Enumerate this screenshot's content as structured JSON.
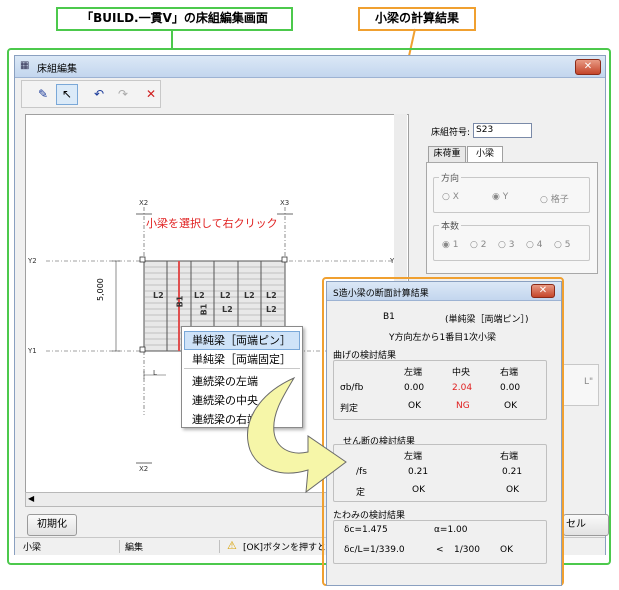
{
  "callouts": {
    "left": "「BUILD.一貫Ⅴ」の床組編集画面",
    "right": "小梁の計算結果"
  },
  "window": {
    "title": "床組編集",
    "close": "✕"
  },
  "toolbar": {
    "pen": "✎",
    "select": "↖",
    "undo": "↶",
    "redo": "↷",
    "delete": "✕"
  },
  "drawing": {
    "axes": [
      "X2",
      "X3",
      "X2",
      "X3",
      "Y2",
      "Y1",
      "Y2"
    ],
    "dimension": "5,000",
    "instruction": "小梁を選択して右クリック",
    "beam_labels": [
      "L2",
      "B1",
      "L2",
      "L2",
      "L2",
      "L2",
      "B1",
      "L2",
      "L2"
    ],
    "corner_label": "L"
  },
  "right_panel": {
    "floor_code_label": "床組符号:",
    "floor_code_value": "S23",
    "tabs": [
      "床荷重",
      "小梁"
    ],
    "direction": {
      "label": "方向",
      "options": [
        "X",
        "Y",
        "格子"
      ]
    },
    "count": {
      "label": "本数",
      "options": [
        "1",
        "2",
        "3",
        "4",
        "5"
      ]
    },
    "hidden_text": "L\""
  },
  "context_menu": {
    "items": [
      "単純梁［両端ピン］",
      "単純梁［両端固定］",
      "連続梁の左端",
      "連続梁の中央",
      "連続梁の右端"
    ]
  },
  "buttons": {
    "init": "初期化",
    "cancel": "セル"
  },
  "status": {
    "cell1": "小梁",
    "cell2": "編集",
    "cell3": "[OK]ボタンを押すと"
  },
  "dialog": {
    "title": "S造小梁の断面計算結果",
    "close": "✕",
    "beam": "B1",
    "beam_type": "(単純梁［両端ピン］)",
    "location": "Y方向左から1番目1次小梁",
    "bending": {
      "label": "曲げの検討結果",
      "col_left": "左端",
      "col_center": "中央",
      "col_right": "右端",
      "row1_label": "σb/fb",
      "row1_values": [
        "0.00",
        "2.04",
        "0.00"
      ],
      "row2_label": "判定",
      "row2_values": [
        "OK",
        "NG",
        "OK"
      ]
    },
    "shear": {
      "label": "せん断の検討結果",
      "col_left": "左端",
      "col_right": "右端",
      "row1_label": "/fs",
      "row1_values": [
        "0.21",
        "0.21"
      ],
      "row2_label": "定",
      "row2_values": [
        "OK",
        "OK"
      ]
    },
    "deflection": {
      "label": "たわみの検討結果",
      "delta_c": "δc=1.475",
      "alpha": "α=1.00",
      "ratio": "δc/L=1/339.0",
      "lt": "<",
      "limit": "1/300",
      "judge": "OK"
    }
  },
  "colors": {
    "green_frame": "#4cc94c",
    "orange_frame": "#f0a030",
    "highlight_beam": "#e05050",
    "ng": "#e02020"
  }
}
